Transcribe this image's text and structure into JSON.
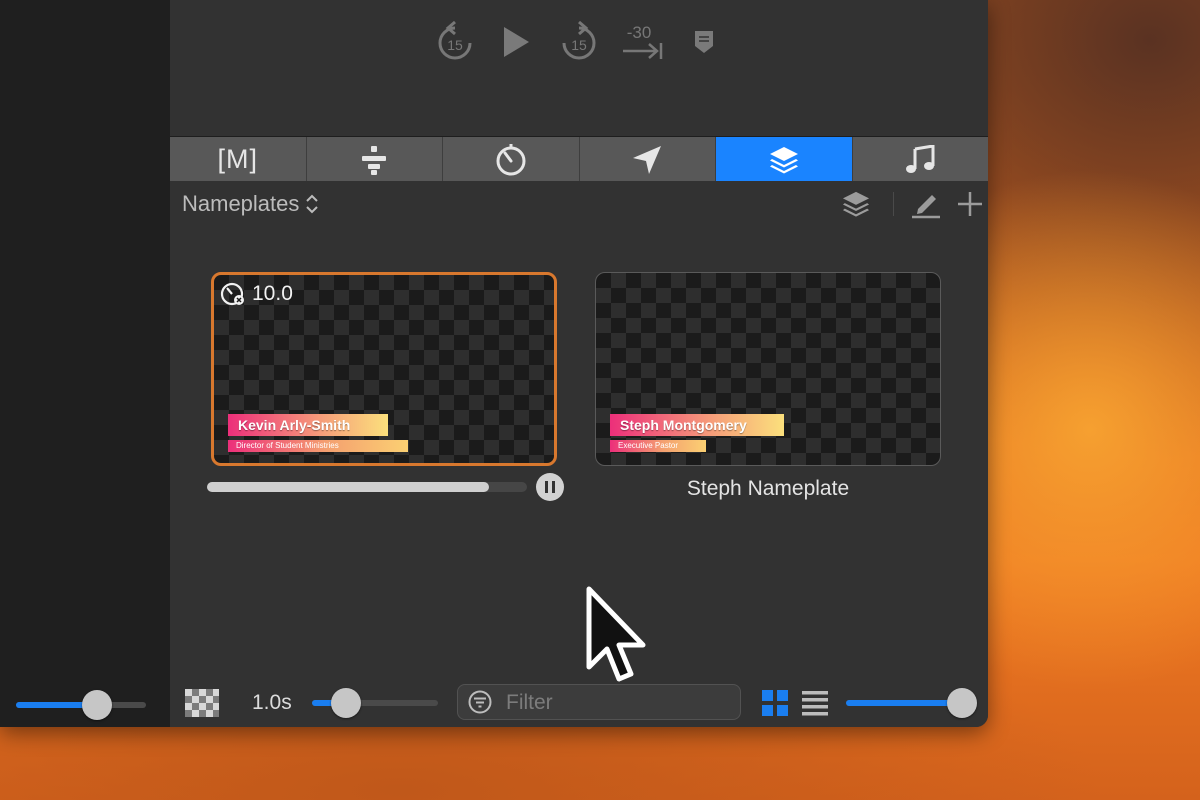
{
  "transport": {
    "rewind_amount": "15",
    "forward_amount": "15",
    "back_seconds": "-30"
  },
  "tabs": [
    {
      "label": "[M]",
      "icon": "macros-icon",
      "active": false
    },
    {
      "icon": "props-icon",
      "active": false
    },
    {
      "icon": "timer-icon",
      "active": false
    },
    {
      "icon": "messages-arrow-icon",
      "active": false
    },
    {
      "icon": "layers-icon",
      "active": true
    },
    {
      "icon": "music-note-icon",
      "active": false
    }
  ],
  "library": {
    "selected": "Nameplates"
  },
  "cues": [
    {
      "timer": "10.0",
      "nameplate_name": "Kevin Arly-Smith",
      "nameplate_title": "Director of Student Ministries",
      "selected": true,
      "progress": 0.88
    },
    {
      "nameplate_name": "Steph Montgomery",
      "nameplate_title": "Executive Pastor",
      "label": "Steph Nameplate",
      "selected": false
    }
  ],
  "footer": {
    "duration": "1.0s",
    "duration_slider": 0.27,
    "filter_placeholder": "Filter",
    "view_mode": "grid",
    "size_slider": 1.0
  },
  "sidebar": {
    "slider": 0.62
  },
  "colors": {
    "accent": "#1a84ff",
    "selection_border": "#d8782e",
    "panel_bg": "#323232"
  }
}
